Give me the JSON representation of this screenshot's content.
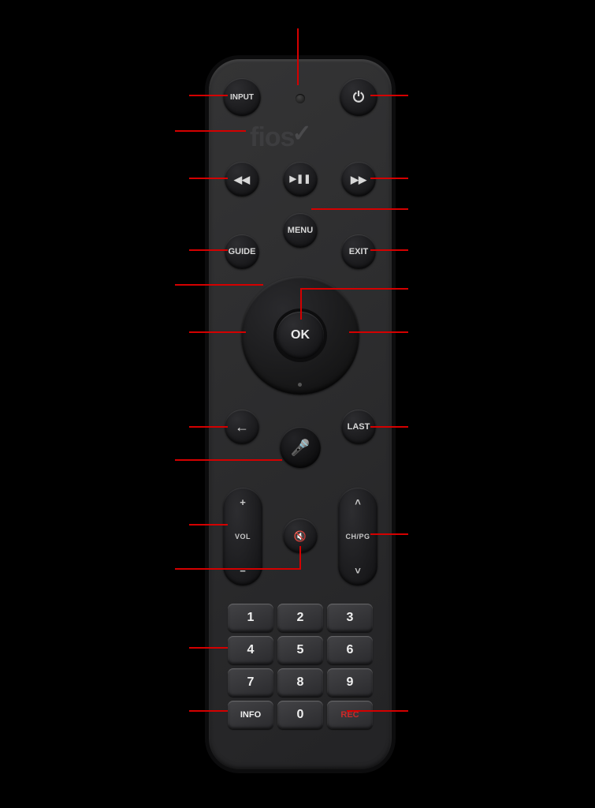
{
  "brand": "fios",
  "buttons": {
    "input": "INPUT",
    "menu": "MENU",
    "guide": "GUIDE",
    "exit": "EXIT",
    "ok": "OK",
    "last": "LAST",
    "vol": "VOL",
    "ch": "CH/PG",
    "info": "INFO",
    "rec": "REC"
  },
  "glyphs": {
    "power": "⏻",
    "rewind": "◀◀",
    "playpause": "▶❚❚",
    "forward": "▶▶",
    "back": "←",
    "mic": "🎤",
    "mute": "🔇",
    "plus": "+",
    "minus": "−",
    "up": "˄",
    "down": "˅"
  },
  "numpad": [
    "1",
    "2",
    "3",
    "4",
    "5",
    "6",
    "7",
    "8",
    "9"
  ],
  "zero": "0"
}
